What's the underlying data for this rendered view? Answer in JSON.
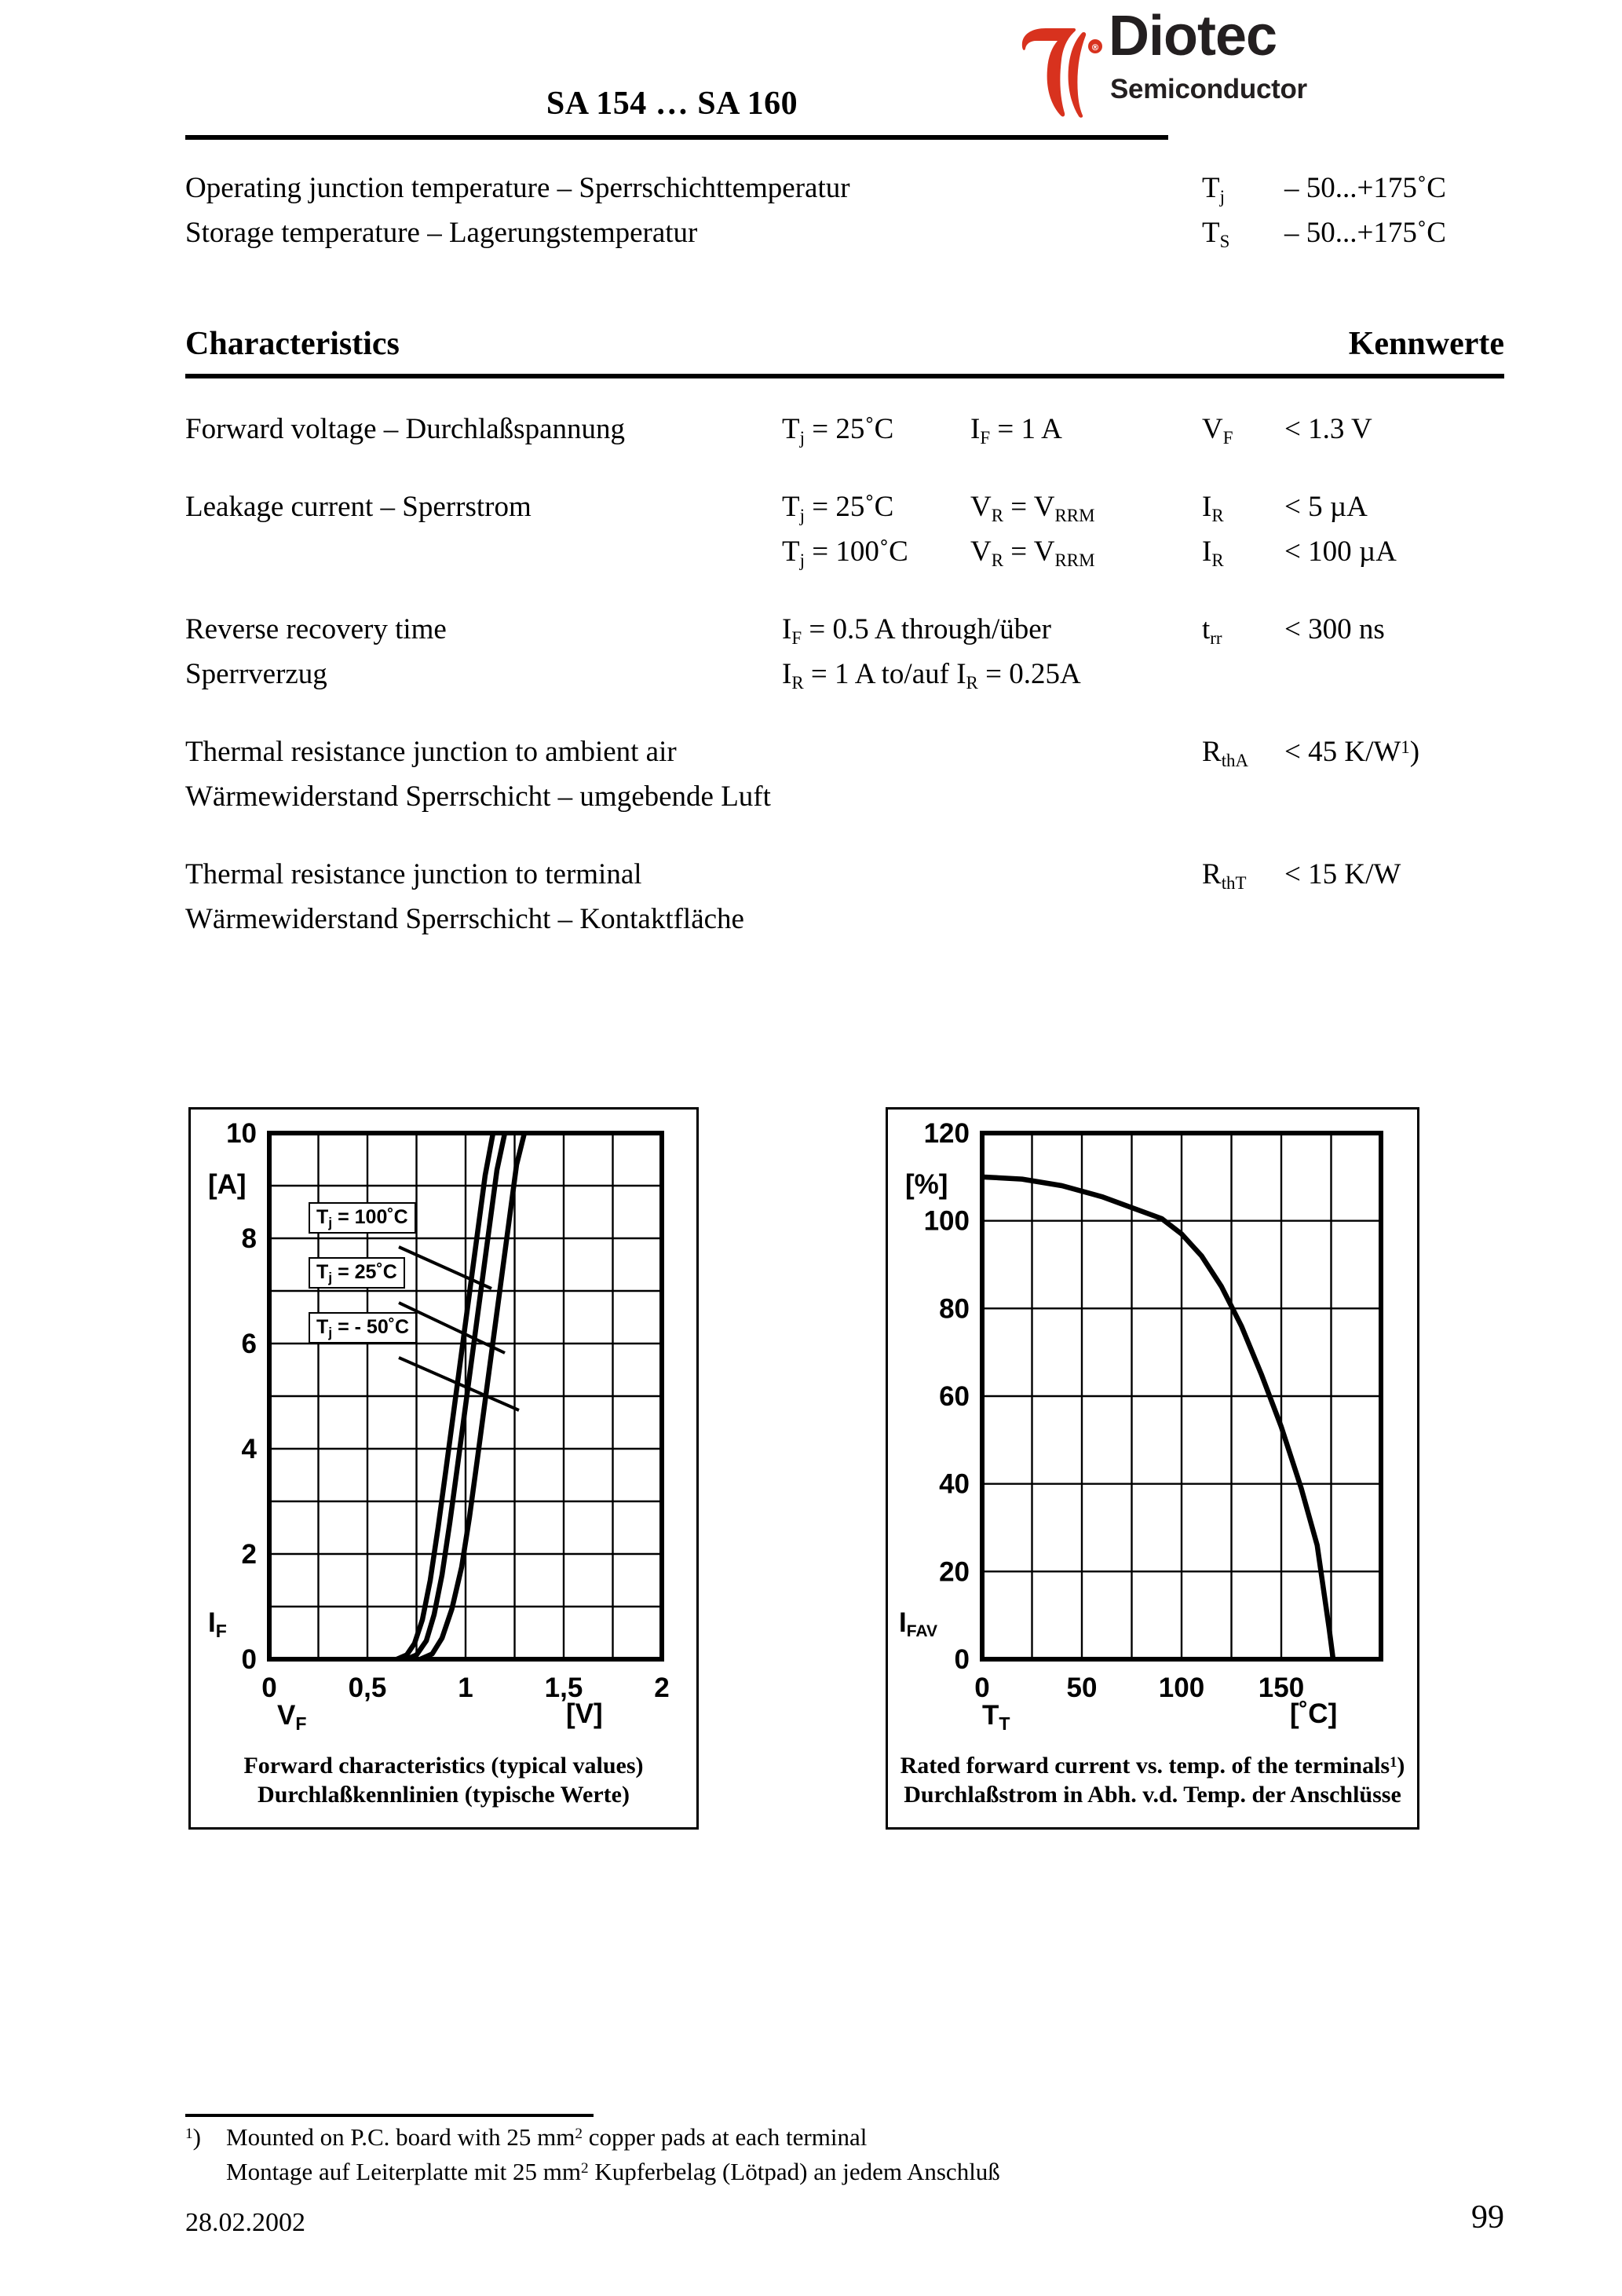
{
  "header": {
    "title": "SA 154 … SA 160",
    "logo_word": "Diotec",
    "logo_sub": "Semiconductor",
    "logo_color": "#d8321e",
    "logo_text_color": "#231f20"
  },
  "temperature_rows": [
    {
      "description": "Operating junction temperature – Sperrschichttemperatur",
      "symbol_base": "T",
      "symbol_sub": "j",
      "value": "– 50...+175˚C"
    },
    {
      "description": "Storage temperature – Lagerungstemperatur",
      "symbol_base": "T",
      "symbol_sub": "S",
      "value": "– 50...+175˚C"
    }
  ],
  "characteristics": {
    "heading_left": "Characteristics",
    "heading_right": "Kennwerte",
    "rows": [
      {
        "description": "Forward voltage – Durchlaßspannung",
        "cond1_base": "T",
        "cond1_sub": "j",
        "cond1_rest": " = 25˚C",
        "cond2_base": "I",
        "cond2_sub": "F",
        "cond2_rest": " = 1 A",
        "sym_base": "V",
        "sym_sub": "F",
        "sym_rest": "",
        "value": "< 1.3 V"
      },
      {
        "description": "Leakage current – Sperrstrom",
        "cond1_base": "T",
        "cond1_sub": "j",
        "cond1_rest": " = 25˚C",
        "cond2_base": "V",
        "cond2_sub": "R",
        "cond2_rest": " = V",
        "cond2_sub2": "RRM",
        "sym_base": "I",
        "sym_sub": "R",
        "sym_rest": "",
        "value": "< 5 µA"
      },
      {
        "description": "",
        "cond1_base": "T",
        "cond1_sub": "j",
        "cond1_rest": " = 100˚C",
        "cond2_base": "V",
        "cond2_sub": "R",
        "cond2_rest": " = V",
        "cond2_sub2": "RRM",
        "sym_base": "I",
        "sym_sub": "R",
        "sym_rest": "",
        "value": "< 100 µA"
      },
      {
        "description": "Reverse recovery time",
        "cond1_base": "I",
        "cond1_sub": "F",
        "cond1_rest": " = 0.5 A through/über",
        "sym_base": "t",
        "sym_sub": "rr",
        "sym_rest": "",
        "value": "< 300 ns"
      },
      {
        "description": "Sperrverzug",
        "cond1_base": "I",
        "cond1_sub": "R",
        "cond1_rest": " = 1 A to/auf I",
        "cond1_sub2": "R",
        "cond1_rest2": " = 0.25A",
        "value": ""
      },
      {
        "description": "Thermal resistance junction to ambient air",
        "sym_base": "R",
        "sym_sub": "thA",
        "sym_rest": "",
        "value": "< 45 K/W",
        "value_sup": "1",
        "value_tail": ")"
      },
      {
        "description": "Wärmewiderstand Sperrschicht – umgebende Luft",
        "value": ""
      },
      {
        "description": "Thermal resistance junction to terminal",
        "sym_base": "R",
        "sym_sub": "thT",
        "sym_rest": "",
        "value": "< 15 K/W"
      },
      {
        "description": "Wärmewiderstand Sperrschicht – Kontaktfläche",
        "value": ""
      }
    ]
  },
  "chart_data": [
    {
      "id": "forward-characteristics",
      "type": "line",
      "title": "Forward characteristics (typical values)",
      "subtitle": "Durchlaßkennlinien (typische Werte)",
      "xlabel_sym": "V",
      "xlabel_sub": "F",
      "xunit": "[V]",
      "ylabel_sym": "I",
      "ylabel_sub": "F",
      "yunit": "[A]",
      "xlim": [
        0,
        2
      ],
      "ylim": [
        0,
        10
      ],
      "xticks": [
        0,
        0.5,
        1,
        1.5,
        2
      ],
      "xtick_labels": [
        "0",
        "0,5",
        "1",
        "1,5",
        "2"
      ],
      "yticks": [
        0,
        2,
        4,
        6,
        8,
        10
      ],
      "ytick_labels": [
        "0",
        "2",
        "4",
        "6",
        "8",
        "10"
      ],
      "grid": true,
      "grid_x_step": 0.25,
      "grid_y_step": 1,
      "legend_position": "inside-left",
      "series": [
        {
          "name": "Tj = 100˚C",
          "label_base": "T",
          "label_sub": "j",
          "label_rest": " = 100˚C",
          "points": [
            [
              0.65,
              0.0
            ],
            [
              0.7,
              0.08
            ],
            [
              0.74,
              0.3
            ],
            [
              0.78,
              0.75
            ],
            [
              0.82,
              1.5
            ],
            [
              0.86,
              2.5
            ],
            [
              0.9,
              3.6
            ],
            [
              0.95,
              5.0
            ],
            [
              1.0,
              6.4
            ],
            [
              1.05,
              7.8
            ],
            [
              1.1,
              9.2
            ],
            [
              1.14,
              10.0
            ]
          ]
        },
        {
          "name": "Tj = 25˚C",
          "label_base": "T",
          "label_sub": "j",
          "label_rest": " = 25˚C",
          "points": [
            [
              0.7,
              0.0
            ],
            [
              0.75,
              0.08
            ],
            [
              0.8,
              0.35
            ],
            [
              0.84,
              0.85
            ],
            [
              0.88,
              1.6
            ],
            [
              0.92,
              2.6
            ],
            [
              0.96,
              3.7
            ],
            [
              1.01,
              5.1
            ],
            [
              1.06,
              6.5
            ],
            [
              1.11,
              7.9
            ],
            [
              1.16,
              9.3
            ],
            [
              1.2,
              10.0
            ]
          ]
        },
        {
          "name": "Tj = - 50˚C",
          "label_base": "T",
          "label_sub": "j",
          "label_rest": " = - 50˚C",
          "points": [
            [
              0.77,
              0.0
            ],
            [
              0.83,
              0.1
            ],
            [
              0.88,
              0.4
            ],
            [
              0.93,
              0.95
            ],
            [
              0.98,
              1.75
            ],
            [
              1.02,
              2.7
            ],
            [
              1.06,
              3.8
            ],
            [
              1.11,
              5.2
            ],
            [
              1.16,
              6.6
            ],
            [
              1.21,
              8.0
            ],
            [
              1.26,
              9.4
            ],
            [
              1.3,
              10.0
            ]
          ]
        }
      ]
    },
    {
      "id": "rated-forward-current-vs-terminal-temp",
      "type": "line",
      "title": "Rated forward current vs. temp. of the terminals",
      "title_sup": "1",
      "title_tail": ")",
      "subtitle": "Durchlaßstrom in Abh. v.d. Temp. der Anschlüsse",
      "xlabel_sym": "T",
      "xlabel_sub": "T",
      "xunit": "[˚C]",
      "ylabel_sym": "I",
      "ylabel_sub": "FAV",
      "yunit": "[%]",
      "xlim": [
        0,
        200
      ],
      "ylim": [
        0,
        120
      ],
      "xticks": [
        0,
        50,
        100,
        150
      ],
      "xtick_labels": [
        "0",
        "50",
        "100",
        "150"
      ],
      "yticks": [
        0,
        20,
        40,
        60,
        80,
        100,
        120
      ],
      "ytick_labels": [
        "0",
        "20",
        "40",
        "60",
        "80",
        "100",
        "120"
      ],
      "grid": true,
      "grid_x_step": 25,
      "grid_y_step": 20,
      "legend_position": "none",
      "series": [
        {
          "name": "IFAV",
          "points": [
            [
              0,
              110
            ],
            [
              20,
              109.5
            ],
            [
              40,
              108
            ],
            [
              60,
              105.5
            ],
            [
              75,
              103
            ],
            [
              90,
              100.5
            ],
            [
              100,
              97
            ],
            [
              110,
              92
            ],
            [
              120,
              85
            ],
            [
              130,
              76
            ],
            [
              140,
              65
            ],
            [
              150,
              53
            ],
            [
              160,
              39
            ],
            [
              168,
              26
            ],
            [
              174,
              7
            ],
            [
              176,
              0
            ]
          ]
        }
      ]
    }
  ],
  "footnote": {
    "marker": "1",
    "marker_tail": ")",
    "line1_a": "Mounted on P.C. board with 25 mm",
    "line1_sup": "2",
    "line1_b": " copper pads at each terminal",
    "line2_a": "Montage auf Leiterplatte mit 25 mm",
    "line2_sup": "2",
    "line2_b": " Kupferbelag (Lötpad) an jedem Anschluß"
  },
  "footer": {
    "date": "28.02.2002",
    "page": "99"
  }
}
